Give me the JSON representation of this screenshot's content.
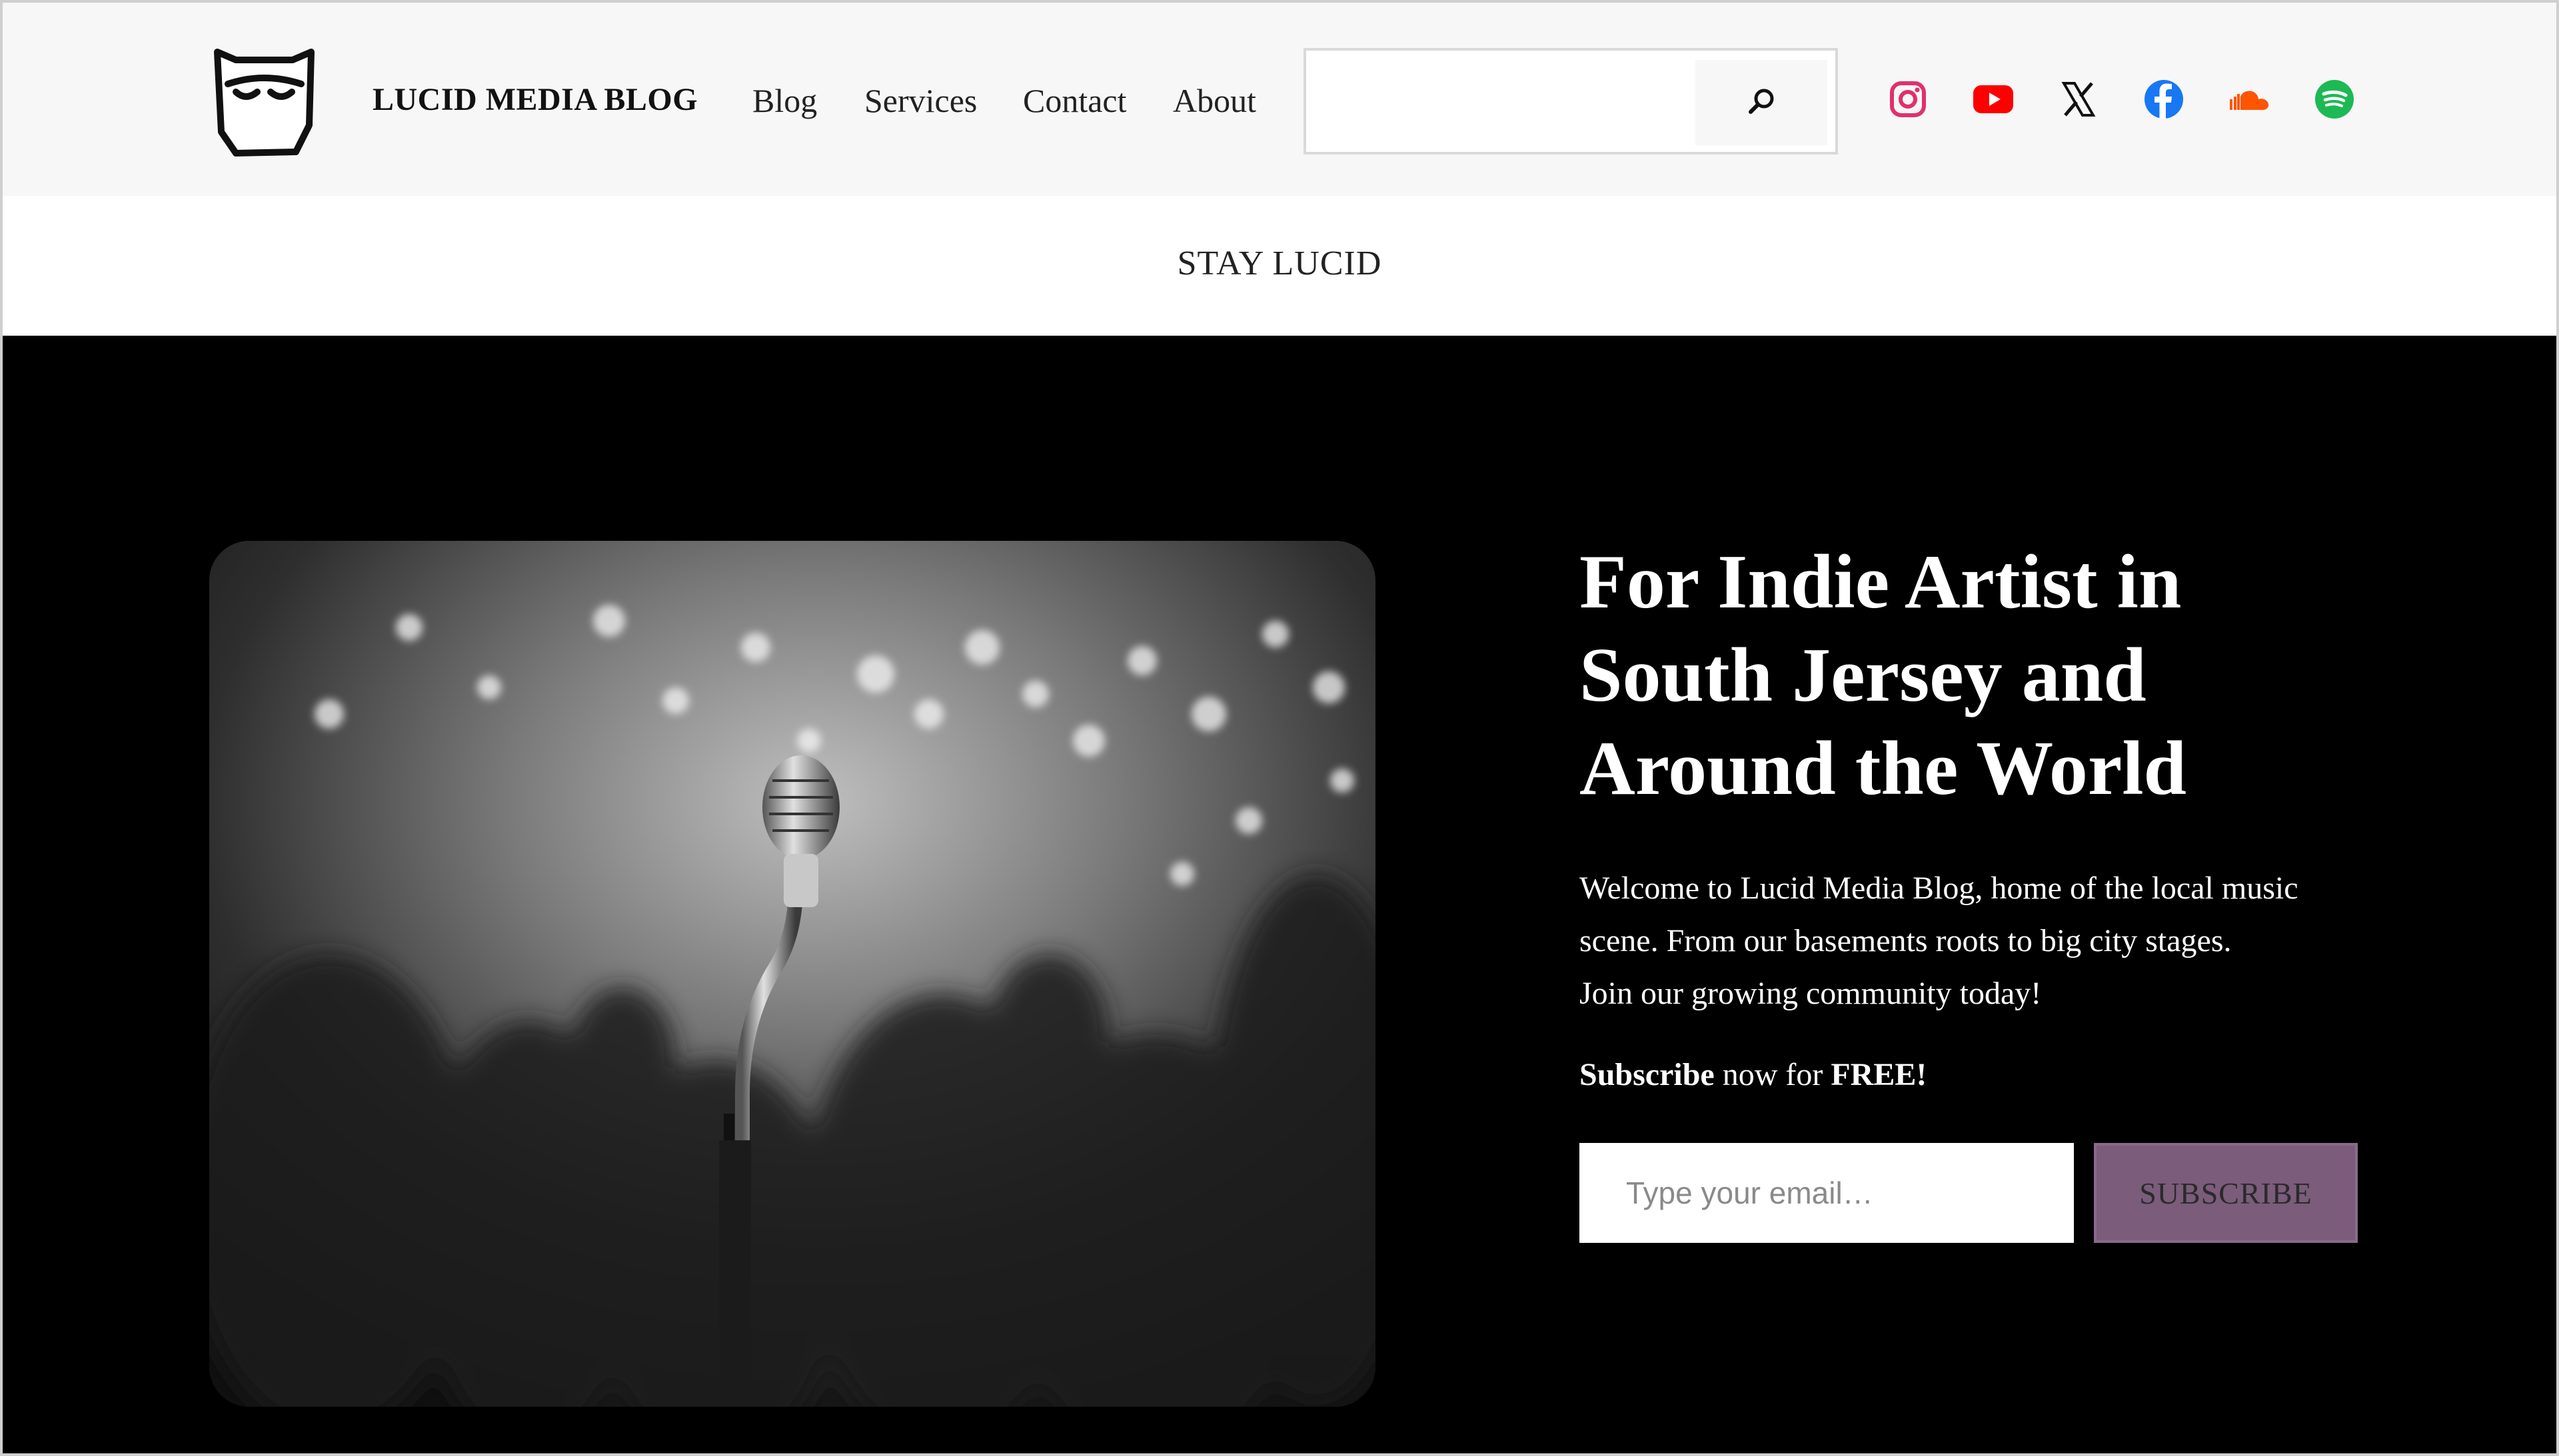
{
  "header": {
    "brand": "LUCID MEDIA BLOG",
    "nav": {
      "blog": "Blog",
      "services": "Services",
      "contact": "Contact",
      "about": "About"
    },
    "search": {
      "placeholder": "",
      "value": "",
      "icon": "search-icon"
    },
    "social": [
      {
        "name": "instagram-icon",
        "color": "#e1306c"
      },
      {
        "name": "youtube-icon",
        "color": "#ff0000"
      },
      {
        "name": "x-icon",
        "color": "#111111"
      },
      {
        "name": "facebook-icon",
        "color": "#1877f2"
      },
      {
        "name": "soundcloud-icon",
        "color": "#ff5500"
      },
      {
        "name": "spotify-icon",
        "color": "#1db954"
      }
    ]
  },
  "tagline": "STAY LUCID",
  "hero": {
    "headline": "For Indie Artist in South Jersey and Around the World",
    "intro_line1": "Welcome to Lucid Media Blog, home of the local music",
    "intro_line2": "scene. From our basements roots to big city stages.",
    "intro_line3": "Join our growing community today!",
    "subscribe_strong1": "Subscribe",
    "subscribe_mid": " now for ",
    "subscribe_strong2": "FREE!",
    "email_placeholder": "Type your email…",
    "subscribe_button": "SUBSCRIBE",
    "accent_color": "#7b5c7b"
  }
}
